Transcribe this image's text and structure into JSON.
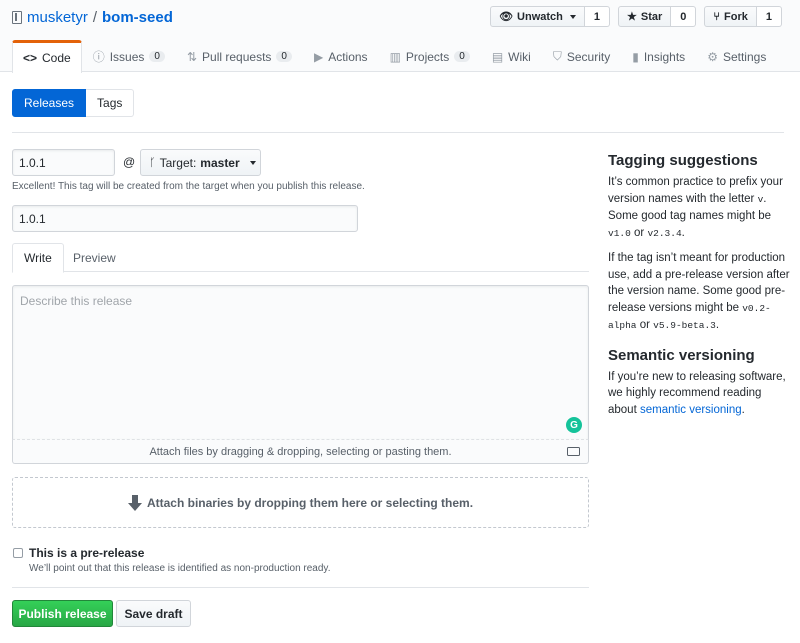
{
  "repo": {
    "owner": "musketyr",
    "separator": "/",
    "name": "bom-seed"
  },
  "actions": {
    "watch": {
      "label": "Unwatch",
      "count": "1"
    },
    "star": {
      "label": "Star",
      "count": "0"
    },
    "fork": {
      "label": "Fork",
      "count": "1"
    }
  },
  "tabs": [
    {
      "label": "Code"
    },
    {
      "label": "Issues",
      "count": "0"
    },
    {
      "label": "Pull requests",
      "count": "0"
    },
    {
      "label": "Actions"
    },
    {
      "label": "Projects",
      "count": "0"
    },
    {
      "label": "Wiki"
    },
    {
      "label": "Security"
    },
    {
      "label": "Insights"
    },
    {
      "label": "Settings"
    }
  ],
  "subnav": {
    "releases": "Releases",
    "tags": "Tags"
  },
  "form": {
    "tag_value": "1.0.1",
    "at": "@",
    "target_prefix": "Target:",
    "target_branch": "master",
    "tag_hint": "Excellent! This tag will be created from the target when you publish this release.",
    "title_value": "1.0.1",
    "editor_tabs": {
      "write": "Write",
      "preview": "Preview"
    },
    "body_placeholder": "Describe this release",
    "attach_files": "Attach files by dragging & dropping, selecting or pasting them.",
    "attach_binaries": "Attach binaries by dropping them here or selecting them.",
    "prerelease_label": "This is a pre-release",
    "prerelease_note": "We’ll point out that this release is identified as non-production ready.",
    "publish_label": "Publish release",
    "save_draft_label": "Save draft"
  },
  "sidebar": {
    "tagging_title": "Tagging suggestions",
    "tagging_p1_a": "It’s common practice to prefix your version names with the letter ",
    "tagging_p1_code1": "v",
    "tagging_p1_b": ". Some good tag names might be ",
    "tagging_p1_code2": "v1.0",
    "tagging_p1_c": " or ",
    "tagging_p1_code3": "v2.3.4",
    "tagging_p1_d": ".",
    "tagging_p2_a": "If the tag isn’t meant for production use, add a pre-release version after the version name. Some good pre-release versions might be ",
    "tagging_p2_code1": "v0.2-alpha",
    "tagging_p2_b": " or ",
    "tagging_p2_code2": "v5.9-beta.3",
    "tagging_p2_c": ".",
    "semver_title": "Semantic versioning",
    "semver_p_a": "If you’re new to releasing software, we highly recommend reading about ",
    "semver_link": "semantic versioning",
    "semver_p_b": "."
  },
  "colors": {
    "link": "#0366d6",
    "primary": "#0366d6",
    "success": "#28a745",
    "tab_accent": "#e36209"
  }
}
